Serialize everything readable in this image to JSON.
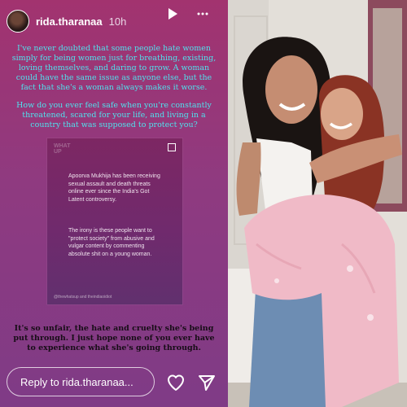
{
  "story": {
    "username": "rida.tharanaa",
    "time": "10h",
    "paragraph1": "I've never doubted that some people hate women simply for being women just for breathing, existing, loving themselves, and daring to grow. A woman could have the same issue as anyone else, but the fact that she's a woman always makes it worse.",
    "paragraph2": "How do you ever feel safe when you're constantly threatened, scared for your life, and living in a country that was supposed to protect you?",
    "card": {
      "logo_line1": "WHAT",
      "logo_line2": "UP",
      "text1": "Apoorva Mukhija has been receiving sexual assault and death threats online ever since the India's Got Latent controversy.",
      "text2": "The irony is these people want to \"protect society\" from abusive and vulgar content by commenting absolute shit on a young woman.",
      "credit": "@thewhatsup and theindiaoidiot"
    },
    "paragraph3": "It's so unfair, the hate and cruelty she's being put through. I just hope none of you ever have to experience what she's going through.",
    "reply_placeholder": "Reply to rida.tharanaa..."
  },
  "icons": {
    "play": "play-icon",
    "more": "more-icon",
    "heart": "heart-icon",
    "send": "send-icon"
  },
  "colors": {
    "caption_text": "#4fe3ee",
    "story_bg": "#9b3574",
    "dark_text": "#170d17"
  }
}
